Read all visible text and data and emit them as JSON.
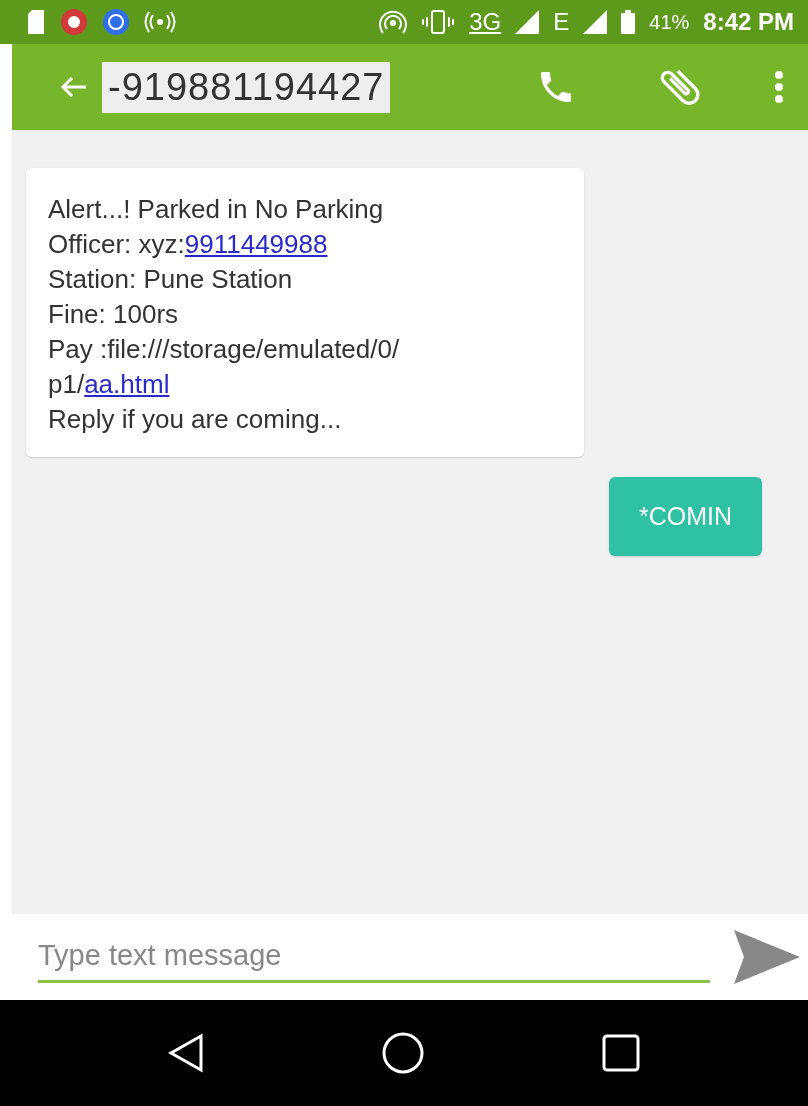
{
  "status_bar": {
    "network": "3G",
    "network_2": "E",
    "battery": "41%",
    "time": "8:42 PM"
  },
  "toolbar": {
    "title": "-919881194427",
    "title_selected": true
  },
  "messages": [
    {
      "kind": "incoming",
      "lines": [
        {
          "text": "Alert...! Parked in No Parking"
        },
        {
          "text": "Officer: xyz:",
          "link": "9911449988"
        },
        {
          "text": "Station: Pune Station"
        },
        {
          "text": "Fine: 100rs"
        },
        {
          "text": "Pay :file:///storage/emulated/0/"
        },
        {
          "text": "p1/",
          "link": "aa.html"
        },
        {
          "text": "Reply if you are coming..."
        }
      ]
    },
    {
      "kind": "outgoing",
      "lines": [
        {
          "text": "*COMIN"
        }
      ]
    }
  ],
  "composer": {
    "placeholder": "Type text message"
  }
}
